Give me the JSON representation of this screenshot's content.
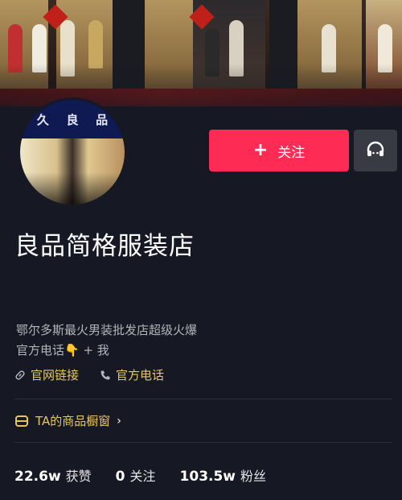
{
  "avatar": {
    "sign_chars": [
      "久",
      "良",
      "品"
    ]
  },
  "actions": {
    "follow_label": "关注",
    "follow_icon": "plus-icon",
    "service_icon": "headset-icon"
  },
  "profile": {
    "name": "良品简格服装店",
    "bio_line1": "鄂尔多斯最火男装批发店超级火爆",
    "bio_line2": "官方电话👇 + 我"
  },
  "links": [
    {
      "label": "官网链接",
      "icon": "link-icon"
    },
    {
      "label": "官方电话",
      "icon": "phone-icon"
    }
  ],
  "shop_window": {
    "label": "TA的商品橱窗",
    "icon": "shop-window-icon"
  },
  "stats": [
    {
      "value": "22.6w",
      "label": "获赞"
    },
    {
      "value": "0",
      "label": "关注"
    },
    {
      "value": "103.5w",
      "label": "粉丝"
    }
  ],
  "colors": {
    "accent": "#fe2c55",
    "link": "#e6c75f",
    "background": "#161823"
  }
}
